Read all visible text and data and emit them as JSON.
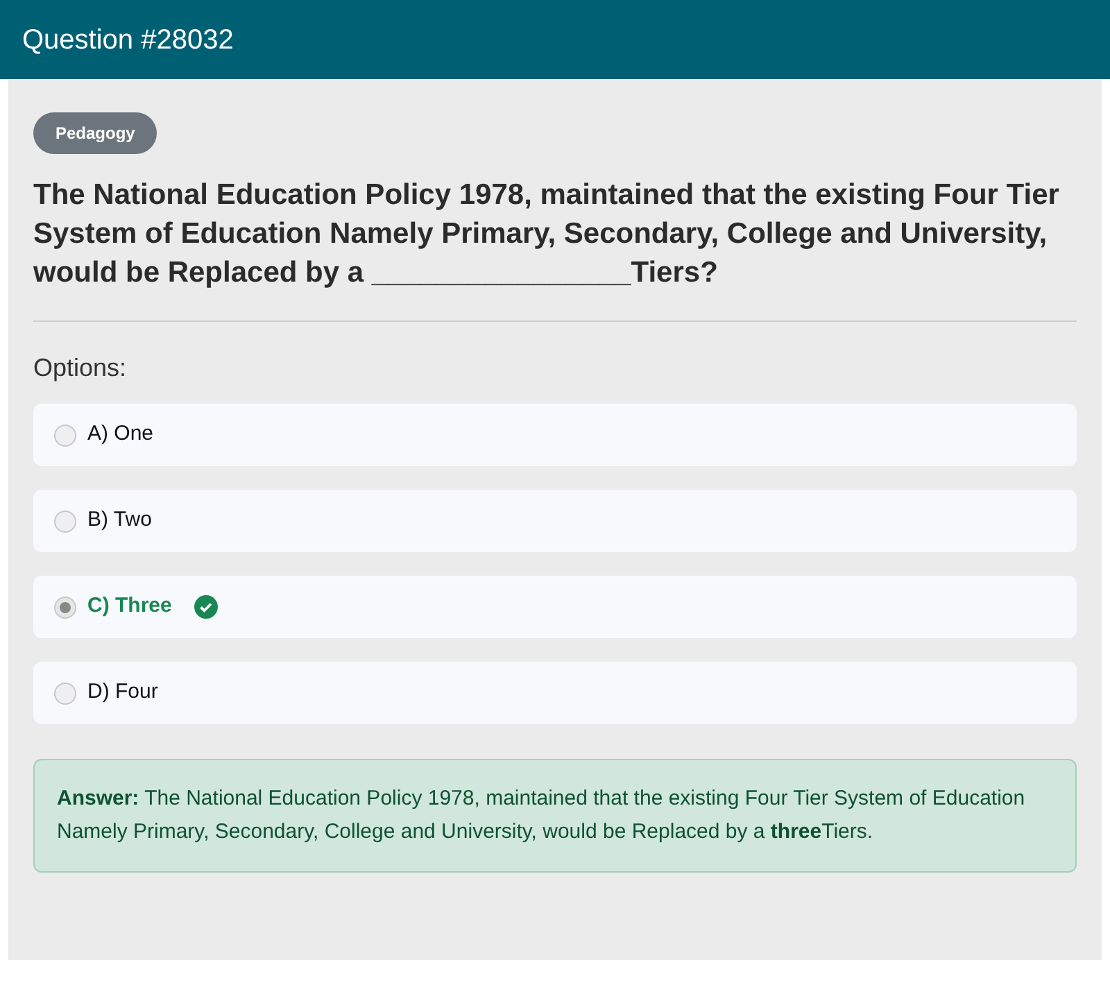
{
  "header": {
    "title": "Question #28032"
  },
  "category": "Pedagogy",
  "question": "The National Education Policy 1978, maintained that the existing Four Tier System of Education Namely Primary, Secondary, College and University, would be Replaced by a ________________Tiers?",
  "options_label": "Options:",
  "options": [
    {
      "label": "A) One",
      "selected": false,
      "correct": false
    },
    {
      "label": "B) Two",
      "selected": false,
      "correct": false
    },
    {
      "label": "C) Three",
      "selected": true,
      "correct": true
    },
    {
      "label": "D) Four",
      "selected": false,
      "correct": false
    }
  ],
  "answer": "**Answer:** The National Education Policy 1978, maintained that the existing Four Tier System of Education Namely Primary, Secondary, College and University, would be Replaced by a **three**Tiers."
}
